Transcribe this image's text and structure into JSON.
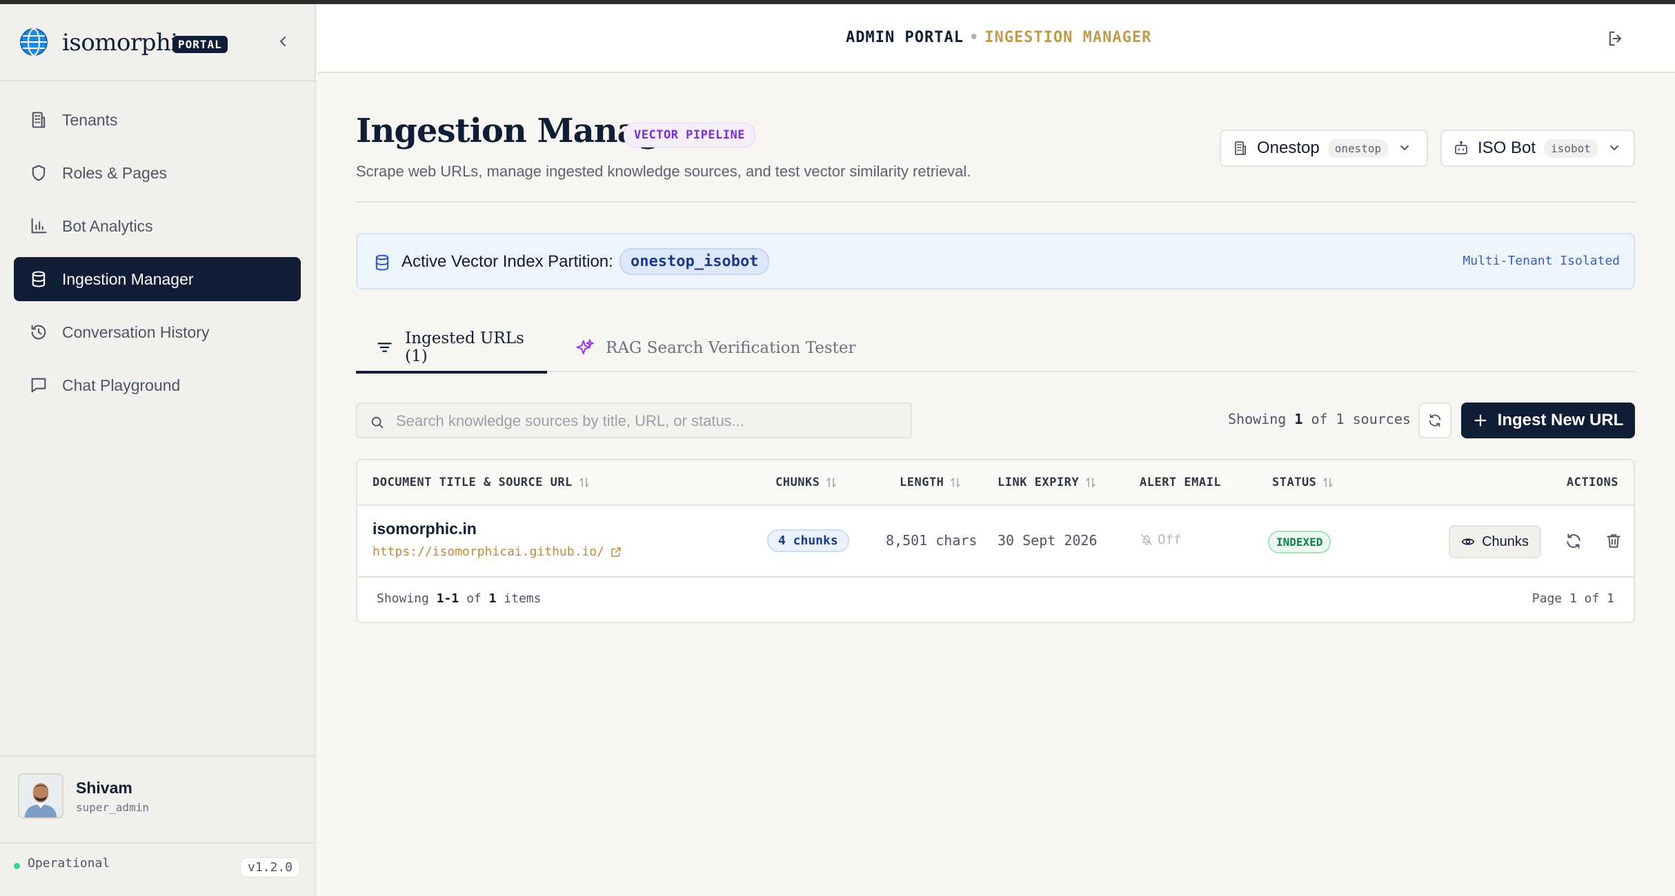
{
  "brand": {
    "name": "isomorphic",
    "badge": "PORTAL"
  },
  "sidebar": {
    "items": [
      {
        "label": "Tenants",
        "icon": "building-icon"
      },
      {
        "label": "Roles & Pages",
        "icon": "shield-icon"
      },
      {
        "label": "Bot Analytics",
        "icon": "bar-chart-icon"
      },
      {
        "label": "Ingestion Manager",
        "icon": "database-icon",
        "active": true
      },
      {
        "label": "Conversation History",
        "icon": "history-icon"
      },
      {
        "label": "Chat Playground",
        "icon": "message-square-icon"
      }
    ],
    "user": {
      "name": "Shivam",
      "role": "super_admin"
    },
    "status": "Operational",
    "version": "v1.2.0"
  },
  "header": {
    "crumb_root": "ADMIN PORTAL",
    "crumb_current": "INGESTION MANAGER"
  },
  "page": {
    "title": "Ingestion Manager",
    "badge": "VECTOR PIPELINE",
    "subtitle": "Scrape web URLs, manage ingested knowledge sources, and test vector similarity retrieval."
  },
  "selectors": {
    "tenant": {
      "label": "Onestop",
      "tag": "onestop"
    },
    "bot": {
      "label": "ISO Bot",
      "tag": "isobot"
    }
  },
  "partition": {
    "label": "Active Vector Index Partition:",
    "value": "onestop_isobot",
    "note": "Multi-Tenant Isolated"
  },
  "tabs": [
    {
      "label": "Ingested URLs (1)",
      "icon": "filter-lines-icon",
      "active": true
    },
    {
      "label": "RAG Search Verification Tester",
      "icon": "sparkles-icon"
    }
  ],
  "search": {
    "placeholder": "Search knowledge sources by title, URL, or status...",
    "value": ""
  },
  "summary": {
    "prefix": "Showing",
    "shown": "1",
    "of": "of 1 sources"
  },
  "ingest_button": "Ingest New URL",
  "table": {
    "columns": [
      "DOCUMENT TITLE & SOURCE URL",
      "CHUNKS",
      "LENGTH",
      "LINK EXPIRY",
      "ALERT EMAIL",
      "STATUS",
      "ACTIONS"
    ],
    "rows": [
      {
        "title": "isomorphic.in",
        "url": "https://isomorphicai.github.io/",
        "chunks": "4 chunks",
        "length": "8,501 chars",
        "expiry": "30 Sept 2026",
        "alert": "Off",
        "status": "INDEXED",
        "action_label": "Chunks"
      }
    ],
    "footer": {
      "prefix": "Showing",
      "range": "1-1",
      "of": "of",
      "total": "1",
      "suffix": "items",
      "page": "Page 1 of 1"
    }
  },
  "colors": {
    "navy": "#0f1e36",
    "gold": "#c19a4d",
    "purple": "#7a2ed1",
    "green": "#12804a",
    "blue": "#1b3a8a"
  }
}
